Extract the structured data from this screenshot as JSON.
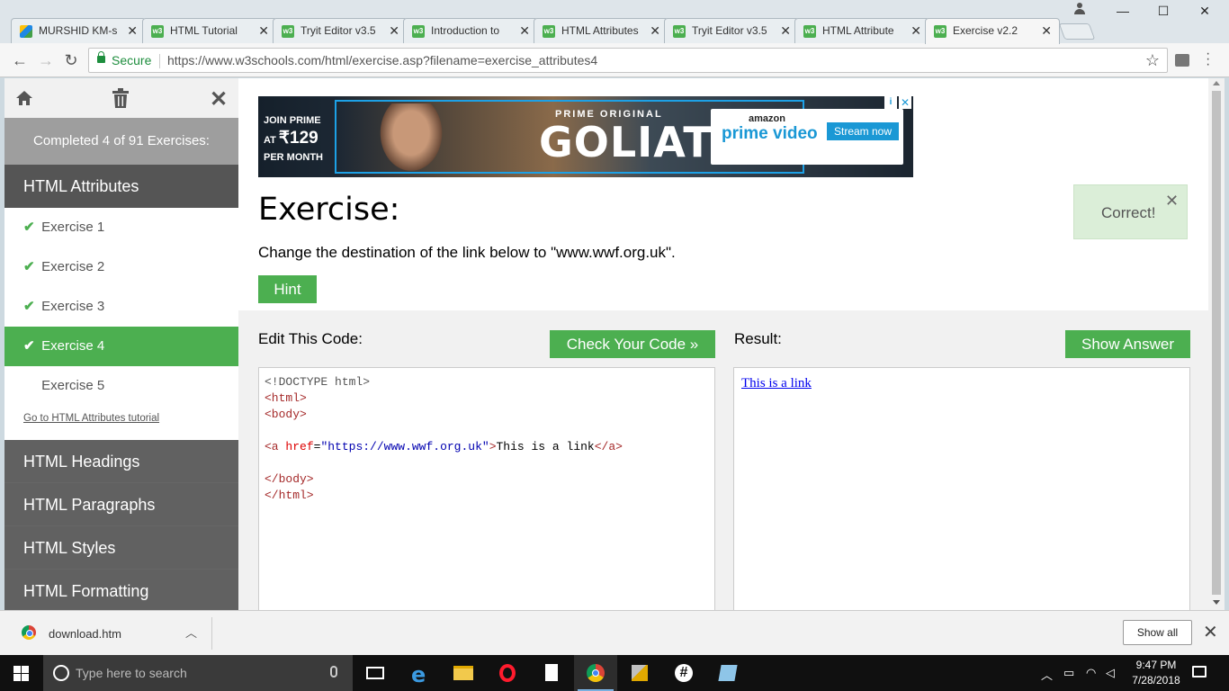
{
  "browser": {
    "tabs": [
      {
        "title": "MURSHID KM-s",
        "icon": "drive-icon"
      },
      {
        "title": "HTML Tutorial",
        "icon": "w3schools-icon"
      },
      {
        "title": "Tryit Editor v3.5",
        "icon": "w3schools-icon"
      },
      {
        "title": "Introduction to",
        "icon": "w3schools-icon"
      },
      {
        "title": "HTML Attributes",
        "icon": "w3schools-icon"
      },
      {
        "title": "Tryit Editor v3.5",
        "icon": "w3schools-icon"
      },
      {
        "title": "HTML Attribute",
        "icon": "w3schools-icon"
      },
      {
        "title": "Exercise v2.2",
        "icon": "w3schools-icon",
        "active": true
      }
    ],
    "tab_icon_text": "w3",
    "secure_label": "Secure",
    "url": "https://www.w3schools.com/html/exercise.asp?filename=exercise_attributes4"
  },
  "sidebar": {
    "progress": "Completed 4 of 91 Exercises:",
    "active_section": "HTML Attributes",
    "exercises": [
      {
        "label": "Exercise 1",
        "done": true
      },
      {
        "label": "Exercise 2",
        "done": true
      },
      {
        "label": "Exercise 3",
        "done": true
      },
      {
        "label": "Exercise 4",
        "done": true,
        "current": true
      },
      {
        "label": "Exercise 5",
        "done": false
      }
    ],
    "tutorial_link": "Go to HTML Attributes tutorial",
    "sections": [
      "HTML Headings",
      "HTML Paragraphs",
      "HTML Styles",
      "HTML Formatting"
    ]
  },
  "ad": {
    "join_prime": "JOIN PRIME",
    "price_prefix": "AT",
    "price": "₹129",
    "per_month": "PER MONTH",
    "prime_original": "PRIME ORIGINAL",
    "title": "GOLIATH",
    "amazon": "amazon",
    "prime_video": "prime video",
    "cta": "Stream now"
  },
  "exercise": {
    "title": "Exercise:",
    "instruction": "Change the destination of the link below to \"www.wwf.org.uk\".",
    "hint_label": "Hint",
    "feedback": "Correct!",
    "edit_label": "Edit This Code:",
    "check_label": "Check Your Code »",
    "result_label": "Result:",
    "answer_label": "Show Answer",
    "code": {
      "doctype": "<!DOCTYPE html>",
      "html_open": "<html>",
      "body_open": "<body>",
      "a_open": "<a",
      "a_attr": "href",
      "a_eq": "=",
      "a_val": "\"https://www.wwf.org.uk\"",
      "a_close_bracket": ">",
      "a_text": "This is a link",
      "a_end": "</a>",
      "body_close": "</body>",
      "html_close": "</html>"
    },
    "result_link_text": "This is a link"
  },
  "downloads": {
    "filename": "download.htm",
    "show_all": "Show all"
  },
  "taskbar": {
    "search_placeholder": "Type here to search",
    "time": "9:47 PM",
    "date": "7/28/2018"
  },
  "colors": {
    "accent_green": "#4caf50",
    "sidebar_gray": "#616161",
    "code_tag": "#a52a2a",
    "code_attr": "#dd0000",
    "code_value": "#0000b0"
  }
}
